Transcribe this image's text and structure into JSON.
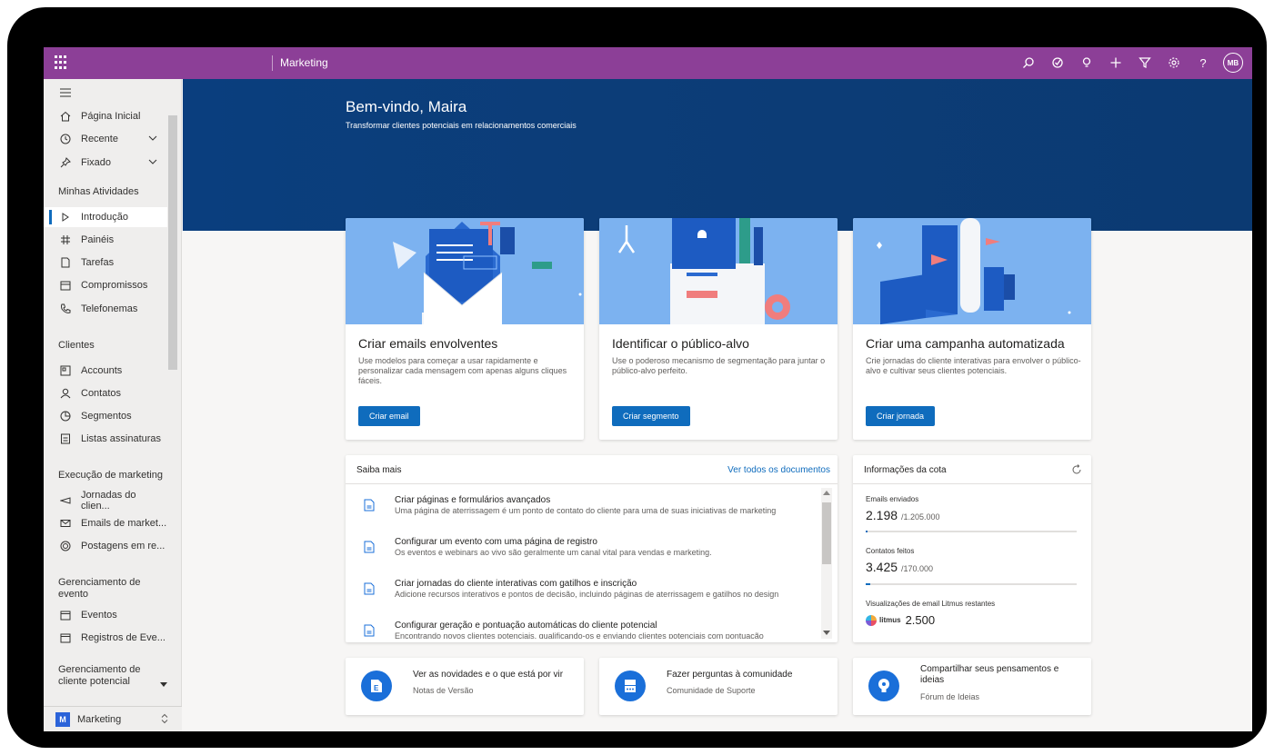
{
  "app": {
    "name": "Marketing",
    "user_initials": "MB"
  },
  "sidebar": {
    "nav": [
      {
        "label": "Página Inicial",
        "icon": "home-icon"
      },
      {
        "label": "Recente",
        "icon": "clock-icon",
        "expandable": true
      },
      {
        "label": "Fixado",
        "icon": "pin-icon",
        "expandable": true
      }
    ],
    "groups": [
      {
        "title": "Minhas Atividades",
        "items": [
          {
            "label": "Introdução",
            "icon": "play-icon",
            "active": true
          },
          {
            "label": "Painéis",
            "icon": "dashboard-icon"
          },
          {
            "label": "Tarefas",
            "icon": "task-icon"
          },
          {
            "label": "Compromissos",
            "icon": "calendar-icon"
          },
          {
            "label": "Telefonemas",
            "icon": "phone-icon"
          }
        ]
      },
      {
        "title": "Clientes",
        "items": [
          {
            "label": "Accounts",
            "icon": "account-icon"
          },
          {
            "label": "Contatos",
            "icon": "person-icon"
          },
          {
            "label": "Segmentos",
            "icon": "segment-icon"
          },
          {
            "label": "Listas assinaturas",
            "icon": "list-icon"
          }
        ]
      },
      {
        "title": "Execução de marketing",
        "items": [
          {
            "label": "Jornadas do clien...",
            "icon": "journey-icon"
          },
          {
            "label": "Emails de market...",
            "icon": "mail-icon"
          },
          {
            "label": "Postagens em re...",
            "icon": "social-icon"
          }
        ]
      },
      {
        "title": "Gerenciamento de evento",
        "items": [
          {
            "label": "Eventos",
            "icon": "event-icon"
          },
          {
            "label": "Registros de Eve...",
            "icon": "event-icon"
          }
        ]
      },
      {
        "title": "Gerenciamento de cliente potencial",
        "items": []
      }
    ],
    "footer": {
      "badge": "M",
      "label": "Marketing"
    }
  },
  "hero": {
    "title": "Bem-vindo, Maira",
    "subtitle": "Transformar clientes potenciais em relacionamentos comerciais"
  },
  "cards": [
    {
      "title": "Criar emails envolventes",
      "desc": "Use modelos para começar a usar rapidamente e personalizar cada mensagem com apenas alguns cliques fáceis.",
      "button": "Criar email"
    },
    {
      "title": "Identificar o público-alvo",
      "desc": "Use o poderoso mecanismo de segmentação para juntar o público-alvo perfeito.",
      "button": "Criar segmento"
    },
    {
      "title": "Criar uma campanha automatizada",
      "desc": "Crie jornadas do cliente interativas para envolver o público-alvo e cultivar seus clientes potenciais.",
      "button": "Criar jornada"
    }
  ],
  "learn": {
    "title": "Saiba mais",
    "link": "Ver todos os documentos",
    "docs": [
      {
        "title": "Criar páginas e formulários avançados",
        "desc": "Uma página de aterrissagem é um ponto de contato do cliente para uma de suas iniciativas de marketing"
      },
      {
        "title": "Configurar um evento com uma página de registro",
        "desc": "Os eventos e webinars ao vivo são geralmente um canal vital para vendas e marketing."
      },
      {
        "title": "Criar jornadas do cliente interativas com gatilhos e inscrição",
        "desc": "Adicione recursos interativos e pontos de decisão, incluindo páginas de aterrissagem e gatilhos no design"
      },
      {
        "title": "Configurar geração e pontuação automáticas do cliente potencial",
        "desc": "Encontrando novos clientes potenciais, qualificando-os e enviando clientes potenciais com pontuação"
      }
    ]
  },
  "quota": {
    "title": "Informações da cota",
    "emails": {
      "label": "Emails enviados",
      "value": "2.198",
      "total": "/1.205.000",
      "fraction": 0.002
    },
    "contacts": {
      "label": "Contatos feitos",
      "value": "3.425",
      "total": "/170.000",
      "fraction": 0.02
    },
    "litmus": {
      "label": "Visualizações de email Litmus restantes",
      "brand": "litmus",
      "value": "2.500"
    }
  },
  "links": [
    {
      "title": "Ver as novidades e o que está por vir",
      "sub": "Notas de Versão",
      "icon": "release-notes-icon"
    },
    {
      "title": "Fazer perguntas à comunidade",
      "sub": "Comunidade de Suporte",
      "icon": "community-icon"
    },
    {
      "title": "Compartilhar seus pensamentos e ideias",
      "sub": "Fórum de Ideias",
      "icon": "lightbulb-icon"
    }
  ],
  "colors": {
    "topbar": "#8c3f97",
    "hero": "#0b3d78",
    "accent": "#0f6cbd"
  }
}
